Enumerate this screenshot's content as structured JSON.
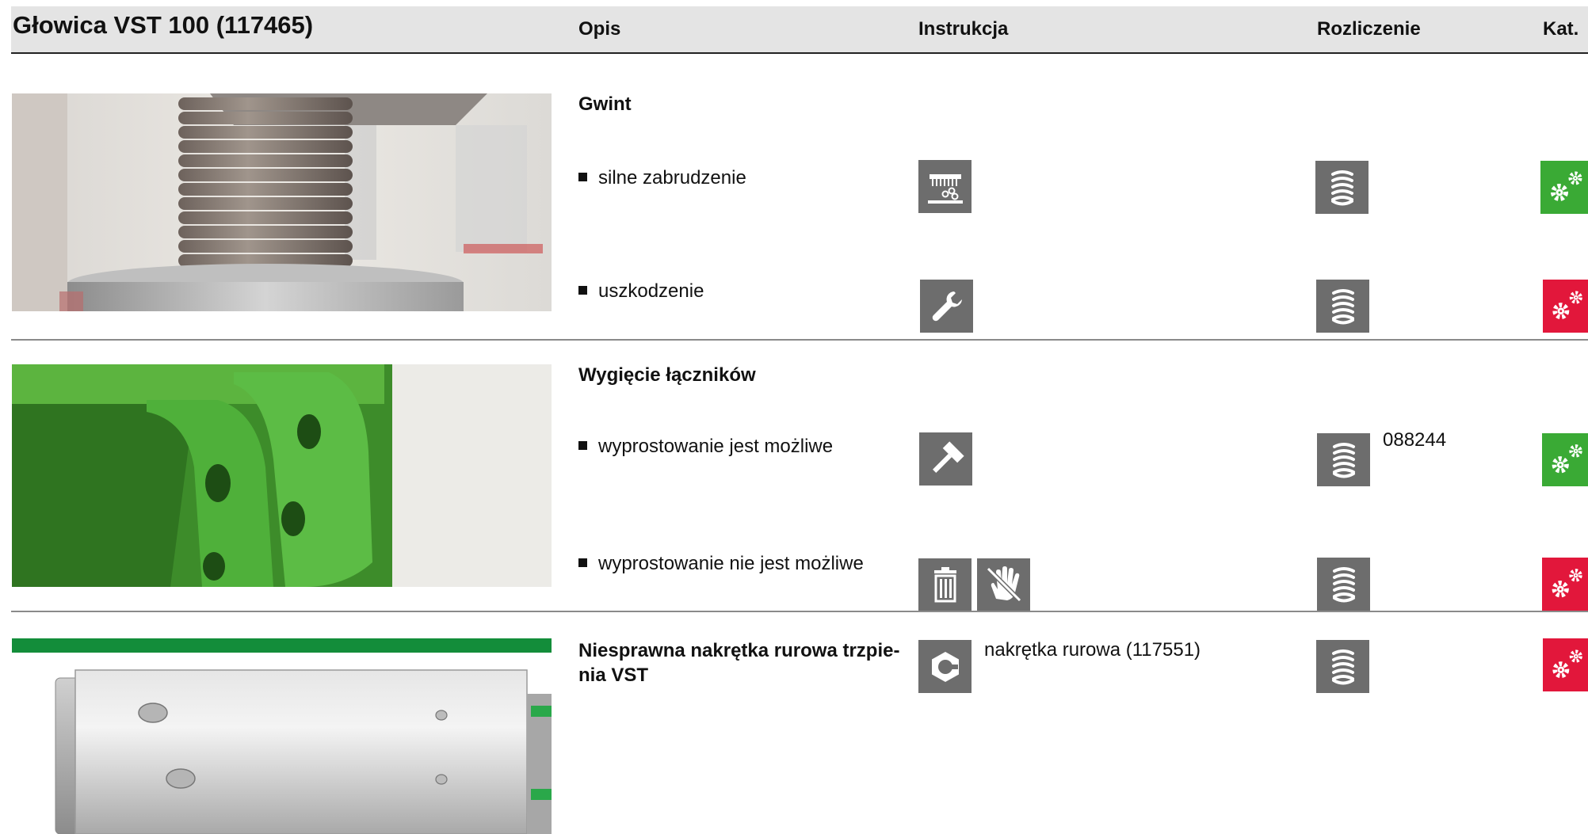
{
  "header": {
    "title": "Głowica VST 100 (117465)",
    "columns": {
      "opis": "Opis",
      "instrukcja": "Instrukcja",
      "rozliczenie": "Rozliczenie",
      "kat": "Kat."
    }
  },
  "sections": [
    {
      "heading": "Gwint",
      "rows": [
        {
          "text": "silne zabrudzenie",
          "instruction_icons": [
            "cleaning-icon"
          ],
          "billing_icon": "parts-stack-icon",
          "part_number": "",
          "category": "green"
        },
        {
          "text": "uszkodzenie",
          "instruction_icons": [
            "wrench-icon"
          ],
          "billing_icon": "parts-stack-icon",
          "part_number": "",
          "category": "red"
        }
      ]
    },
    {
      "heading": "Wygięcie łączników",
      "rows": [
        {
          "text": "wyprostowanie jest możliwe",
          "instruction_icons": [
            "hammer-icon"
          ],
          "billing_icon": "parts-stack-icon",
          "part_number": "088244",
          "category": "green"
        },
        {
          "text": "wyprostowanie nie jest możliwe",
          "instruction_icons": [
            "trash-icon",
            "no-repair-hand-icon"
          ],
          "billing_icon": "parts-stack-icon",
          "part_number": "",
          "category": "red"
        }
      ]
    },
    {
      "heading": "Niesprawna nakrętka rurowa trzpie- nia VST",
      "heading_line1": "Niesprawna nakrętka rurowa trzpie-",
      "heading_line2": "nia VST",
      "rows": [
        {
          "text": "",
          "instruction_icons": [
            "hex-nut-icon"
          ],
          "instruction_text": "nakrętka rurowa (117551)",
          "billing_icon": "parts-stack-icon",
          "part_number": "",
          "category": "red"
        }
      ]
    }
  ],
  "colors": {
    "icon_gray": "#6d6d6d",
    "category_green": "#3aaa35",
    "category_red": "#e2173b",
    "header_bg": "#e4e4e4"
  }
}
